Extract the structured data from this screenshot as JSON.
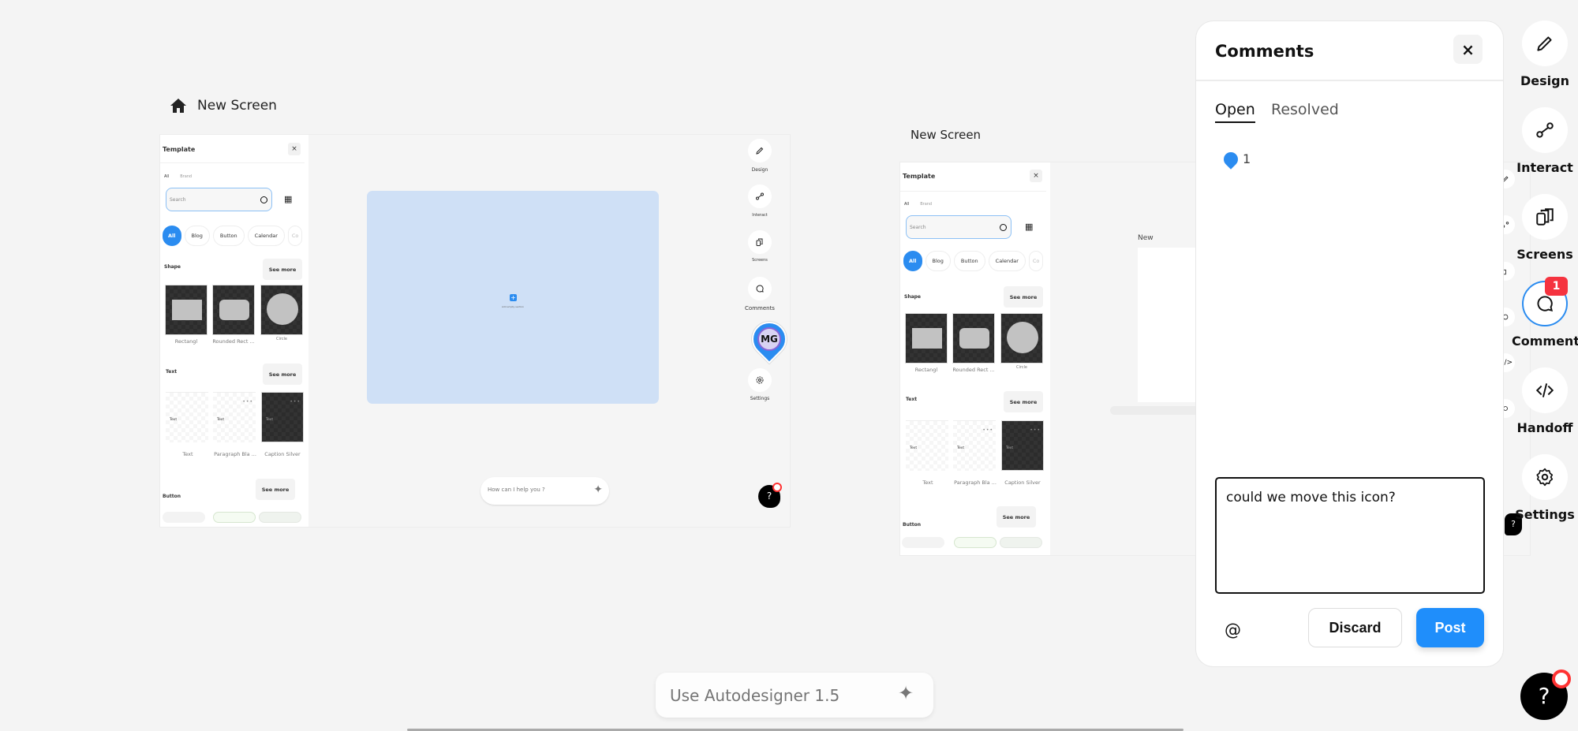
{
  "canvas": {
    "breadcrumb": {
      "icon": "home-icon",
      "label": "New Screen"
    },
    "frame1": {
      "template_panel": {
        "title": "Template",
        "close": "×",
        "tabs": [
          "All",
          "Brand"
        ],
        "search_placeholder": "Search",
        "chips": [
          "All",
          "Blog",
          "Button",
          "Calendar",
          "Co"
        ],
        "sections": {
          "shape": {
            "label": "Shape",
            "see_more": "See more",
            "items": [
              "Rectangl",
              "Rounded Rect ...",
              "Circle"
            ]
          },
          "text": {
            "label": "Text",
            "see_more": "See more",
            "items": [
              "Text",
              "Paragraph Bla ...",
              "Caption Silver"
            ],
            "thumb_text": "Text"
          },
          "button": {
            "label": "Button",
            "see_more": "See more"
          }
        }
      },
      "add_section_label": "Add empty section",
      "rail": [
        "Design",
        "Interact",
        "Screens",
        "Comments",
        "Settings"
      ],
      "avatar_initials": "MG",
      "ask_placeholder": "How can I help you ?",
      "help": "?"
    },
    "frame2": {
      "title": "New Screen",
      "inner_label": "New",
      "help": "?"
    }
  },
  "comments_panel": {
    "title": "Comments",
    "close": "×",
    "tabs": {
      "open": "Open",
      "resolved": "Resolved",
      "active": "open"
    },
    "threads": [
      {
        "number": "1"
      }
    ],
    "draft": "could we move this icon?",
    "mention": "@",
    "discard": "Discard",
    "post": "Post"
  },
  "right_rail": {
    "items": [
      {
        "label": "Design",
        "icon": "pencil-icon"
      },
      {
        "label": "Interact",
        "icon": "interact-icon"
      },
      {
        "label": "Screens",
        "icon": "screens-icon"
      },
      {
        "label": "Comments",
        "icon": "comment-icon",
        "badge": "1",
        "active": true
      },
      {
        "label": "Handoff",
        "icon": "code-icon"
      },
      {
        "label": "Settings",
        "icon": "gear-icon"
      }
    ]
  },
  "autodesigner": {
    "placeholder": "Use Autodesigner 1.5"
  },
  "help": "?",
  "colors": {
    "accent": "#1f8efb",
    "badge": "#f5333f",
    "canvas_section": "#cfe0f6",
    "avatar_ring": "#8765d6"
  }
}
